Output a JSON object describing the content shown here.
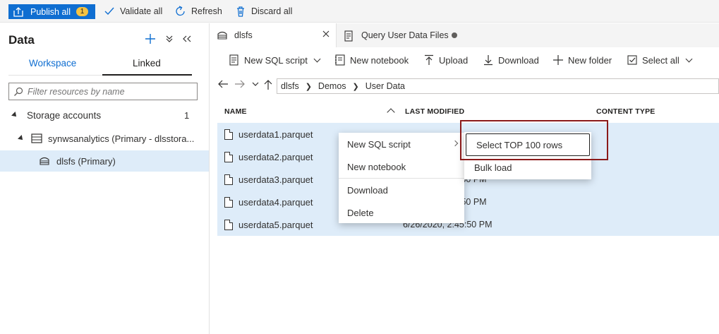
{
  "toolbar": {
    "publish_label": "Publish all",
    "publish_count": "1",
    "validate_label": "Validate all",
    "refresh_label": "Refresh",
    "discard_label": "Discard all"
  },
  "sidebar": {
    "title": "Data",
    "tabs": [
      {
        "label": "Workspace"
      },
      {
        "label": "Linked"
      }
    ],
    "filter_placeholder": "Filter resources by name",
    "tree": {
      "group_label": "Storage accounts",
      "group_count": "1",
      "account_label": "synwsanalytics (Primary - dlsstora...",
      "container_label": "dlsfs (Primary)"
    }
  },
  "tabs": [
    {
      "label": "dlsfs",
      "icon": "storage-icon"
    },
    {
      "label": "Query User Data Files",
      "icon": "script-icon"
    }
  ],
  "commands": {
    "new_sql_script": "New SQL script",
    "new_notebook": "New notebook",
    "upload": "Upload",
    "download": "Download",
    "new_folder": "New folder",
    "select_all": "Select all"
  },
  "breadcrumb": [
    "dlsfs",
    "Demos",
    "User Data"
  ],
  "table": {
    "columns": [
      "NAME",
      "LAST MODIFIED",
      "CONTENT TYPE"
    ],
    "rows": [
      {
        "name": "userdata1.parquet",
        "modified": ""
      },
      {
        "name": "userdata2.parquet",
        "modified": ""
      },
      {
        "name": "userdata3.parquet",
        "modified": ":50 PM"
      },
      {
        "name": "userdata4.parquet",
        "modified": ":50 PM"
      },
      {
        "name": "userdata5.parquet",
        "modified": "6/26/2020, 2:45:50 PM"
      }
    ]
  },
  "context_menu": {
    "items": [
      "New SQL script",
      "New notebook",
      "Download",
      "Delete"
    ]
  },
  "submenu": {
    "items": [
      "Select TOP 100 rows",
      "Bulk load"
    ]
  },
  "colors": {
    "accent": "#0f6ed1",
    "selection": "#deecf9",
    "highlight_border": "#8b1a1a",
    "badge": "#f6c342"
  }
}
